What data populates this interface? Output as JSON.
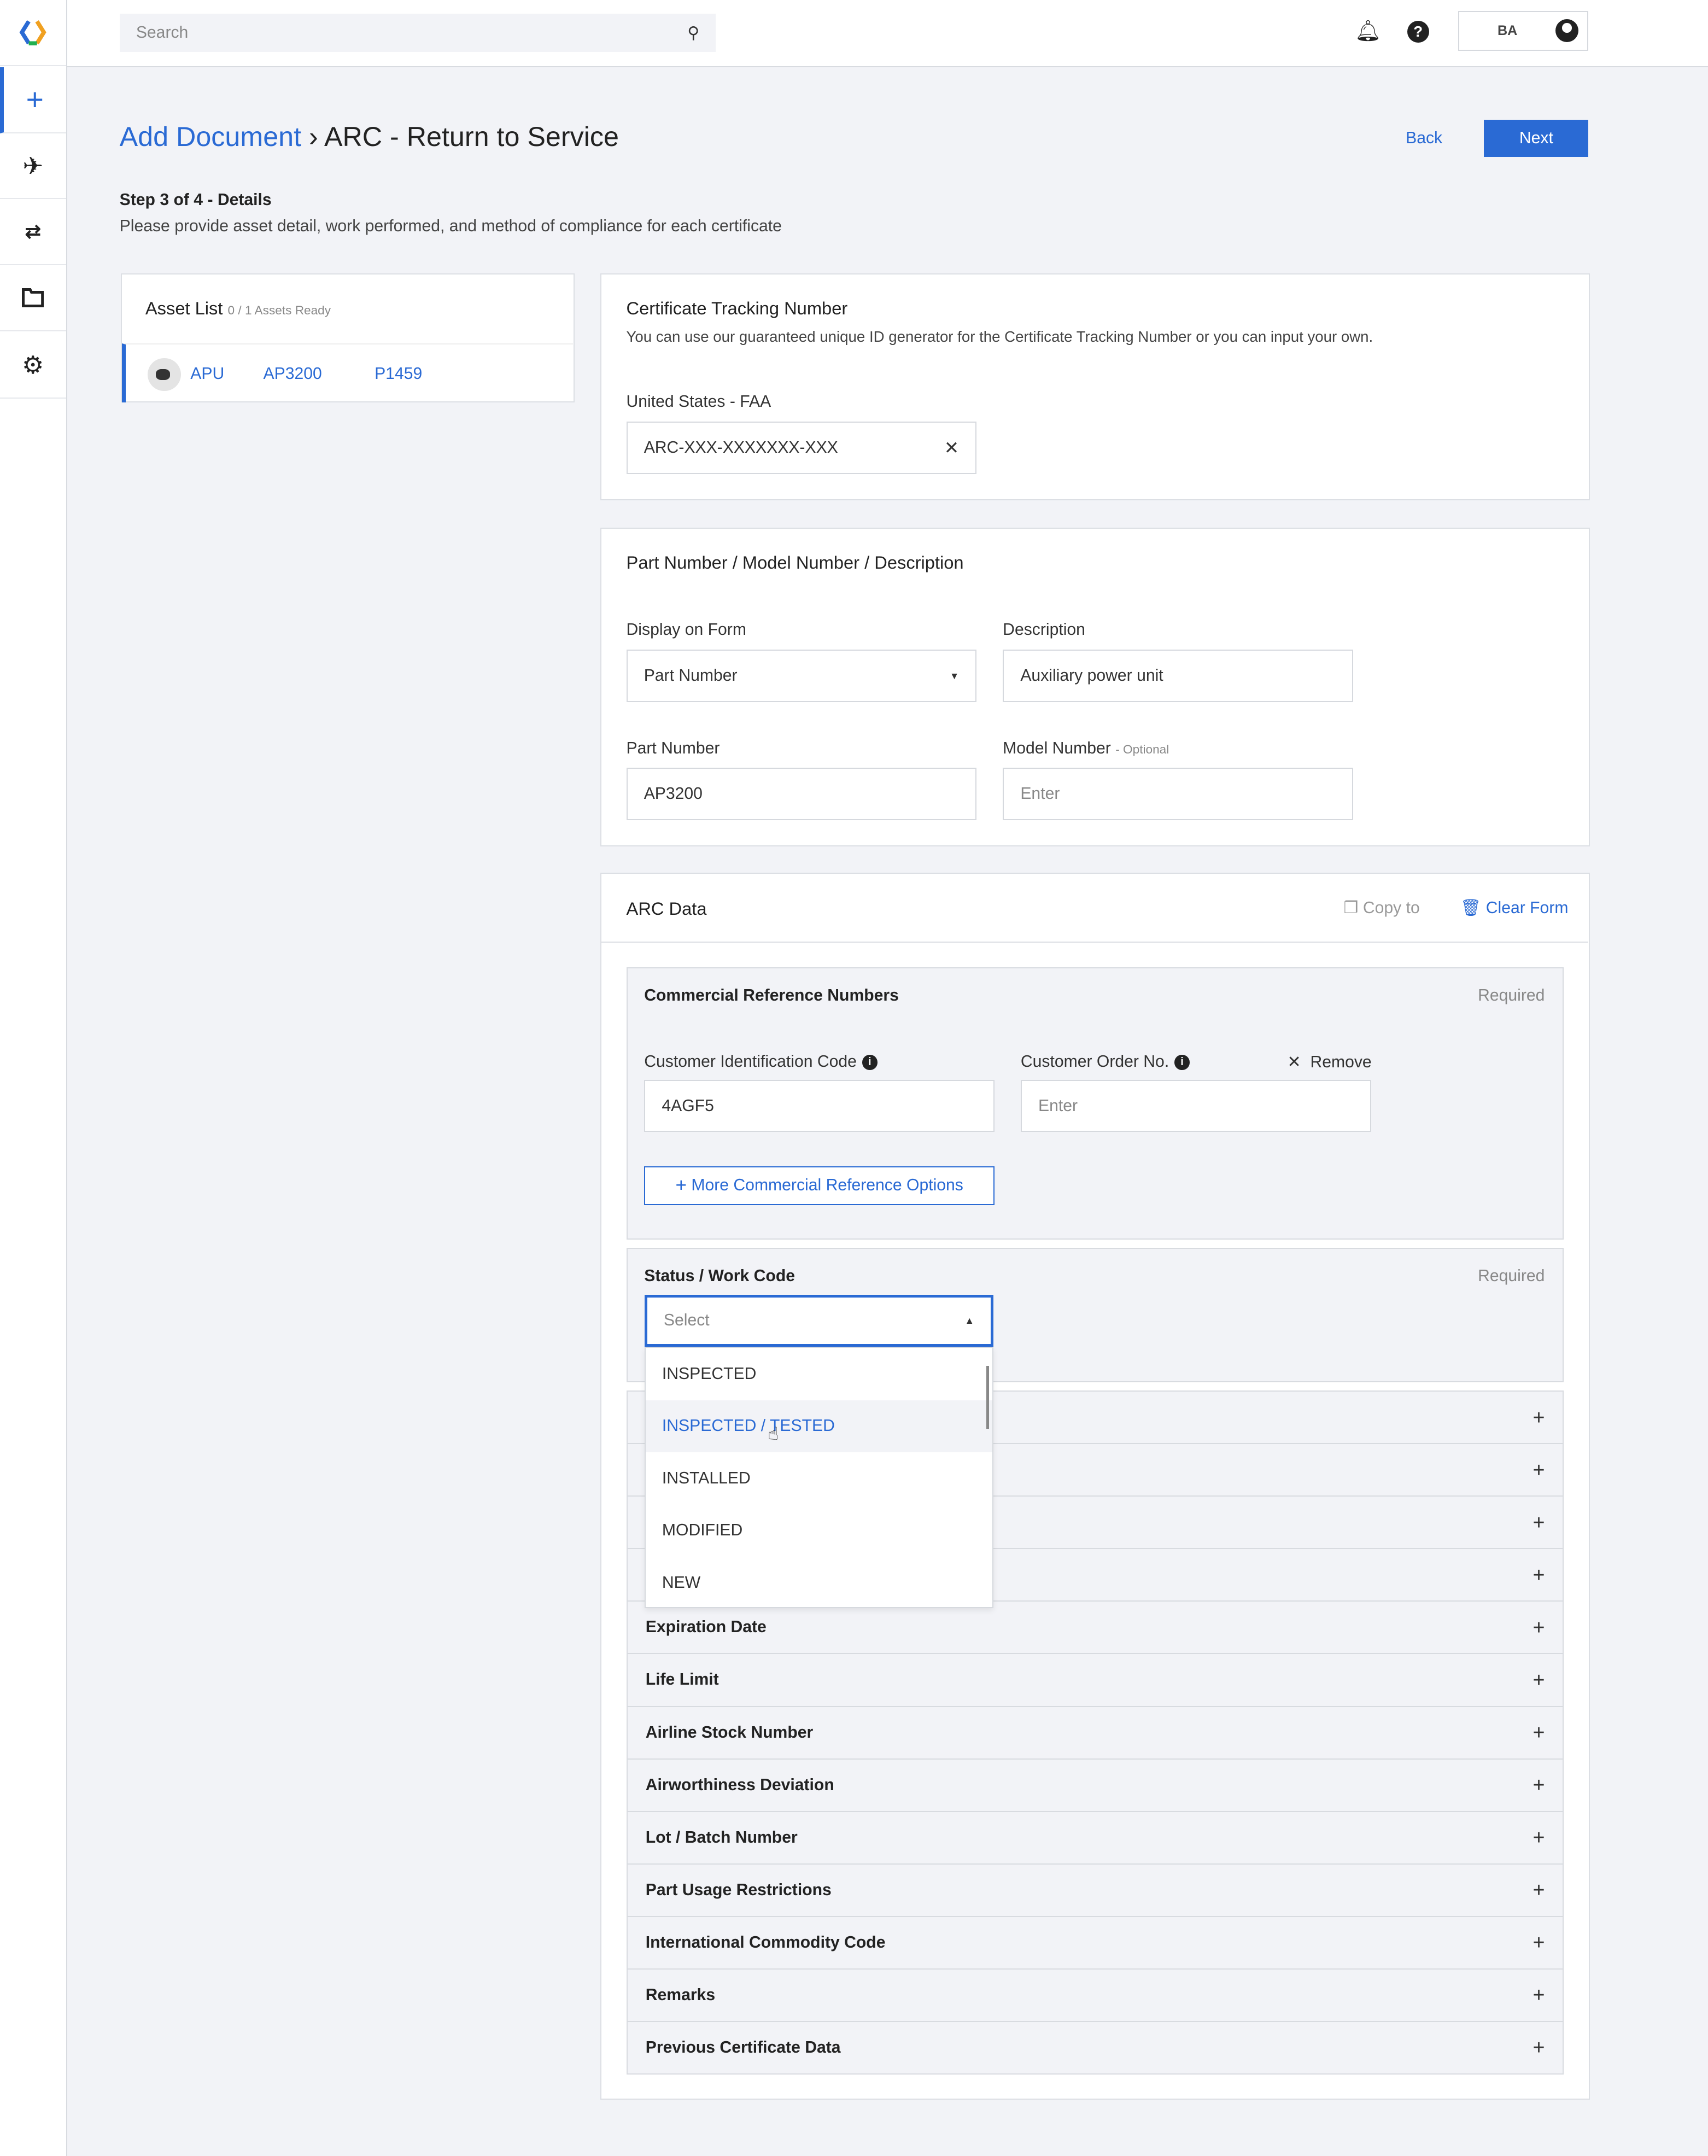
{
  "colors": {
    "accent": "#2a6ad4",
    "background": "#f2f3f7"
  },
  "sidebar": {
    "items": [
      {
        "icon": "plus-icon",
        "active": true
      },
      {
        "icon": "airplane-icon"
      },
      {
        "icon": "transfer-icon"
      },
      {
        "icon": "folder-icon"
      },
      {
        "icon": "gear-icon"
      }
    ]
  },
  "topbar": {
    "search_placeholder": "Search",
    "user_initials": "BA"
  },
  "header": {
    "breadcrumb_link": "Add Document",
    "separator": "›",
    "title": "ARC - Return to Service",
    "back": "Back",
    "next": "Next"
  },
  "step": {
    "title": "Step 3 of 4 - Details",
    "subtitle": "Please provide asset detail, work performed, and method of compliance for each certificate"
  },
  "asset_list": {
    "title": "Asset List",
    "status": "0 / 1 Assets Ready",
    "items": [
      {
        "name": "APU",
        "part": "AP3200",
        "serial": "P1459"
      }
    ]
  },
  "certificate": {
    "title": "Certificate Tracking Number",
    "description": "You can use our guaranteed unique ID generator for the Certificate Tracking Number or you can input your own.",
    "label": "United States - FAA",
    "value": "ARC-XXX-XXXXXXX-XXX"
  },
  "part": {
    "title": "Part Number / Model Number / Description",
    "display_label": "Display on Form",
    "display_value": "Part Number",
    "description_label": "Description",
    "description_value": "Auxiliary power unit",
    "part_label": "Part Number",
    "part_value": "AP3200",
    "model_label": "Model Number",
    "model_optional": "- Optional",
    "model_placeholder": "Enter"
  },
  "arc": {
    "title": "ARC Data",
    "copy_to": "Copy to",
    "clear_form": "Clear Form",
    "commercial": {
      "title": "Commercial Reference Numbers",
      "required": "Required",
      "cic_label": "Customer Identification Code",
      "cic_value": "4AGF5",
      "con_label": "Customer Order No.",
      "con_placeholder": "Enter",
      "remove": "Remove",
      "more": "More Commercial Reference Options"
    },
    "status": {
      "title": "Status / Work Code",
      "required": "Required",
      "placeholder": "Select",
      "options": [
        "INSPECTED",
        "INSPECTED / TESTED",
        "INSTALLED",
        "MODIFIED",
        "NEW"
      ],
      "hovered": "INSPECTED / TESTED"
    },
    "accordions": [
      "",
      "",
      "",
      "",
      "Expiration Date",
      "Life Limit",
      "Airline Stock Number",
      "Airworthiness Deviation",
      "Lot / Batch Number",
      "Part Usage Restrictions",
      "International Commodity Code",
      "Remarks",
      "Previous Certificate Data"
    ]
  }
}
